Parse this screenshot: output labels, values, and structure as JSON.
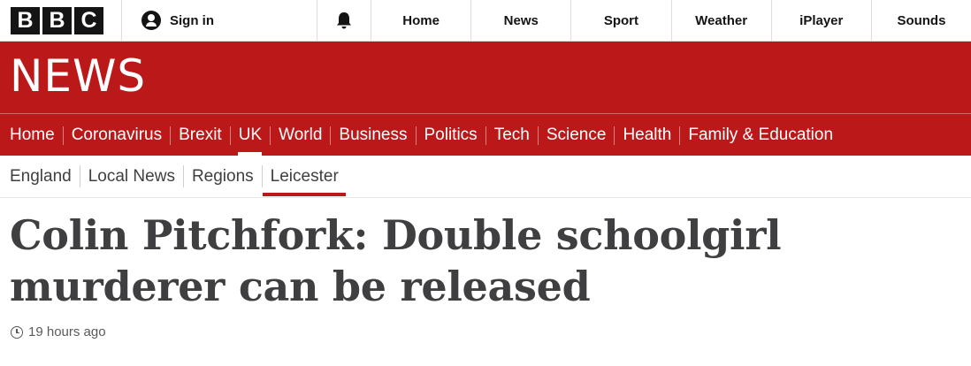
{
  "topbar": {
    "logo_letters": [
      "B",
      "B",
      "C"
    ],
    "signin_label": "Sign in",
    "icons": {
      "account": "account-icon",
      "notifications": "bell-icon"
    },
    "nav": [
      "Home",
      "News",
      "Sport",
      "Weather",
      "iPlayer",
      "Sounds"
    ]
  },
  "banner": {
    "wordmark": "NEWS",
    "color": "#bb1919"
  },
  "section_nav": {
    "items": [
      "Home",
      "Coronavirus",
      "Brexit",
      "UK",
      "World",
      "Business",
      "Politics",
      "Tech",
      "Science",
      "Health",
      "Family & Education"
    ],
    "active": "UK"
  },
  "sub_nav": {
    "items": [
      "England",
      "Local News",
      "Regions",
      "Leicester"
    ],
    "active": "Leicester"
  },
  "article": {
    "headline": "Colin Pitchfork: Double schoolgirl murderer can be released",
    "timestamp": "19 hours ago",
    "timestamp_icon": "clock-icon"
  }
}
